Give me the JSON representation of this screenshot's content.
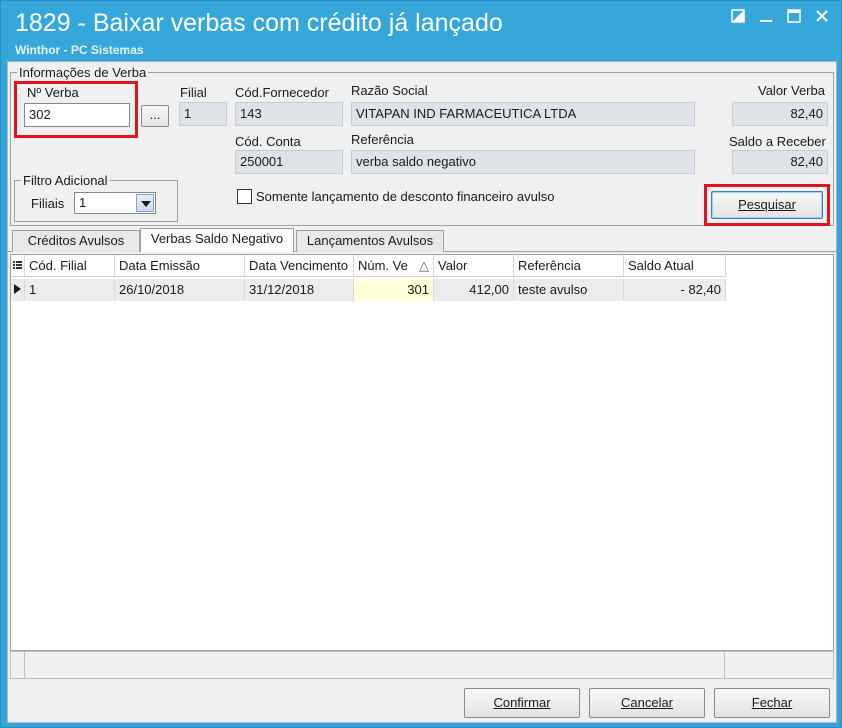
{
  "window": {
    "title": "1829 - Baixar verbas com crédito já lançado",
    "subtitle": "Winthor - PC Sistemas",
    "controls": [
      "restore-icon",
      "minimize-icon",
      "maximize-icon",
      "close-icon"
    ]
  },
  "info_group": {
    "legend": "Informações de Verba",
    "verba_label": "Nº Verba",
    "verba_value": "302",
    "browse_label": "...",
    "filial_label": "Filial",
    "filial_value": "1",
    "fornecedor_label": "Cód.Fornecedor",
    "fornecedor_value": "143",
    "razao_label": "Razão Social",
    "razao_value": "VITAPAN IND FARMACEUTICA LTDA",
    "valor_label": "Valor Verba",
    "valor_value": "82,40",
    "conta_label": "Cód. Conta",
    "conta_value": "250001",
    "referencia_label": "Referência",
    "referencia_value": "verba saldo negativo",
    "saldo_label": "Saldo a Receber",
    "saldo_value": "82,40"
  },
  "filter_group": {
    "legend": "Filtro Adicional",
    "filiais_label": "Filiais",
    "filiais_value": "1"
  },
  "checkbox_label": "Somente lançamento de desconto financeiro avulso",
  "search_button": "Pesquisar",
  "tabs": [
    {
      "label": "Créditos Avulsos",
      "active": false
    },
    {
      "label": "Verbas Saldo Negativo",
      "active": true
    },
    {
      "label": "Lançamentos Avulsos",
      "active": false
    }
  ],
  "grid": {
    "columns": [
      "Cód. Filial",
      "Data Emissão",
      "Data Vencimento",
      "Núm. Ve",
      "Valor",
      "Referência",
      "Saldo Atual"
    ],
    "sort_indicator": "△",
    "rows": [
      [
        "1",
        "26/10/2018",
        "31/12/2018",
        "301",
        "412,00",
        "teste avulso",
        "- 82,40"
      ]
    ]
  },
  "buttons": {
    "confirm": "Confirmar",
    "cancel": "Cancelar",
    "close": "Fechar"
  },
  "colors": {
    "titlebar": "#35a7db",
    "highlight": "#e0141e"
  }
}
